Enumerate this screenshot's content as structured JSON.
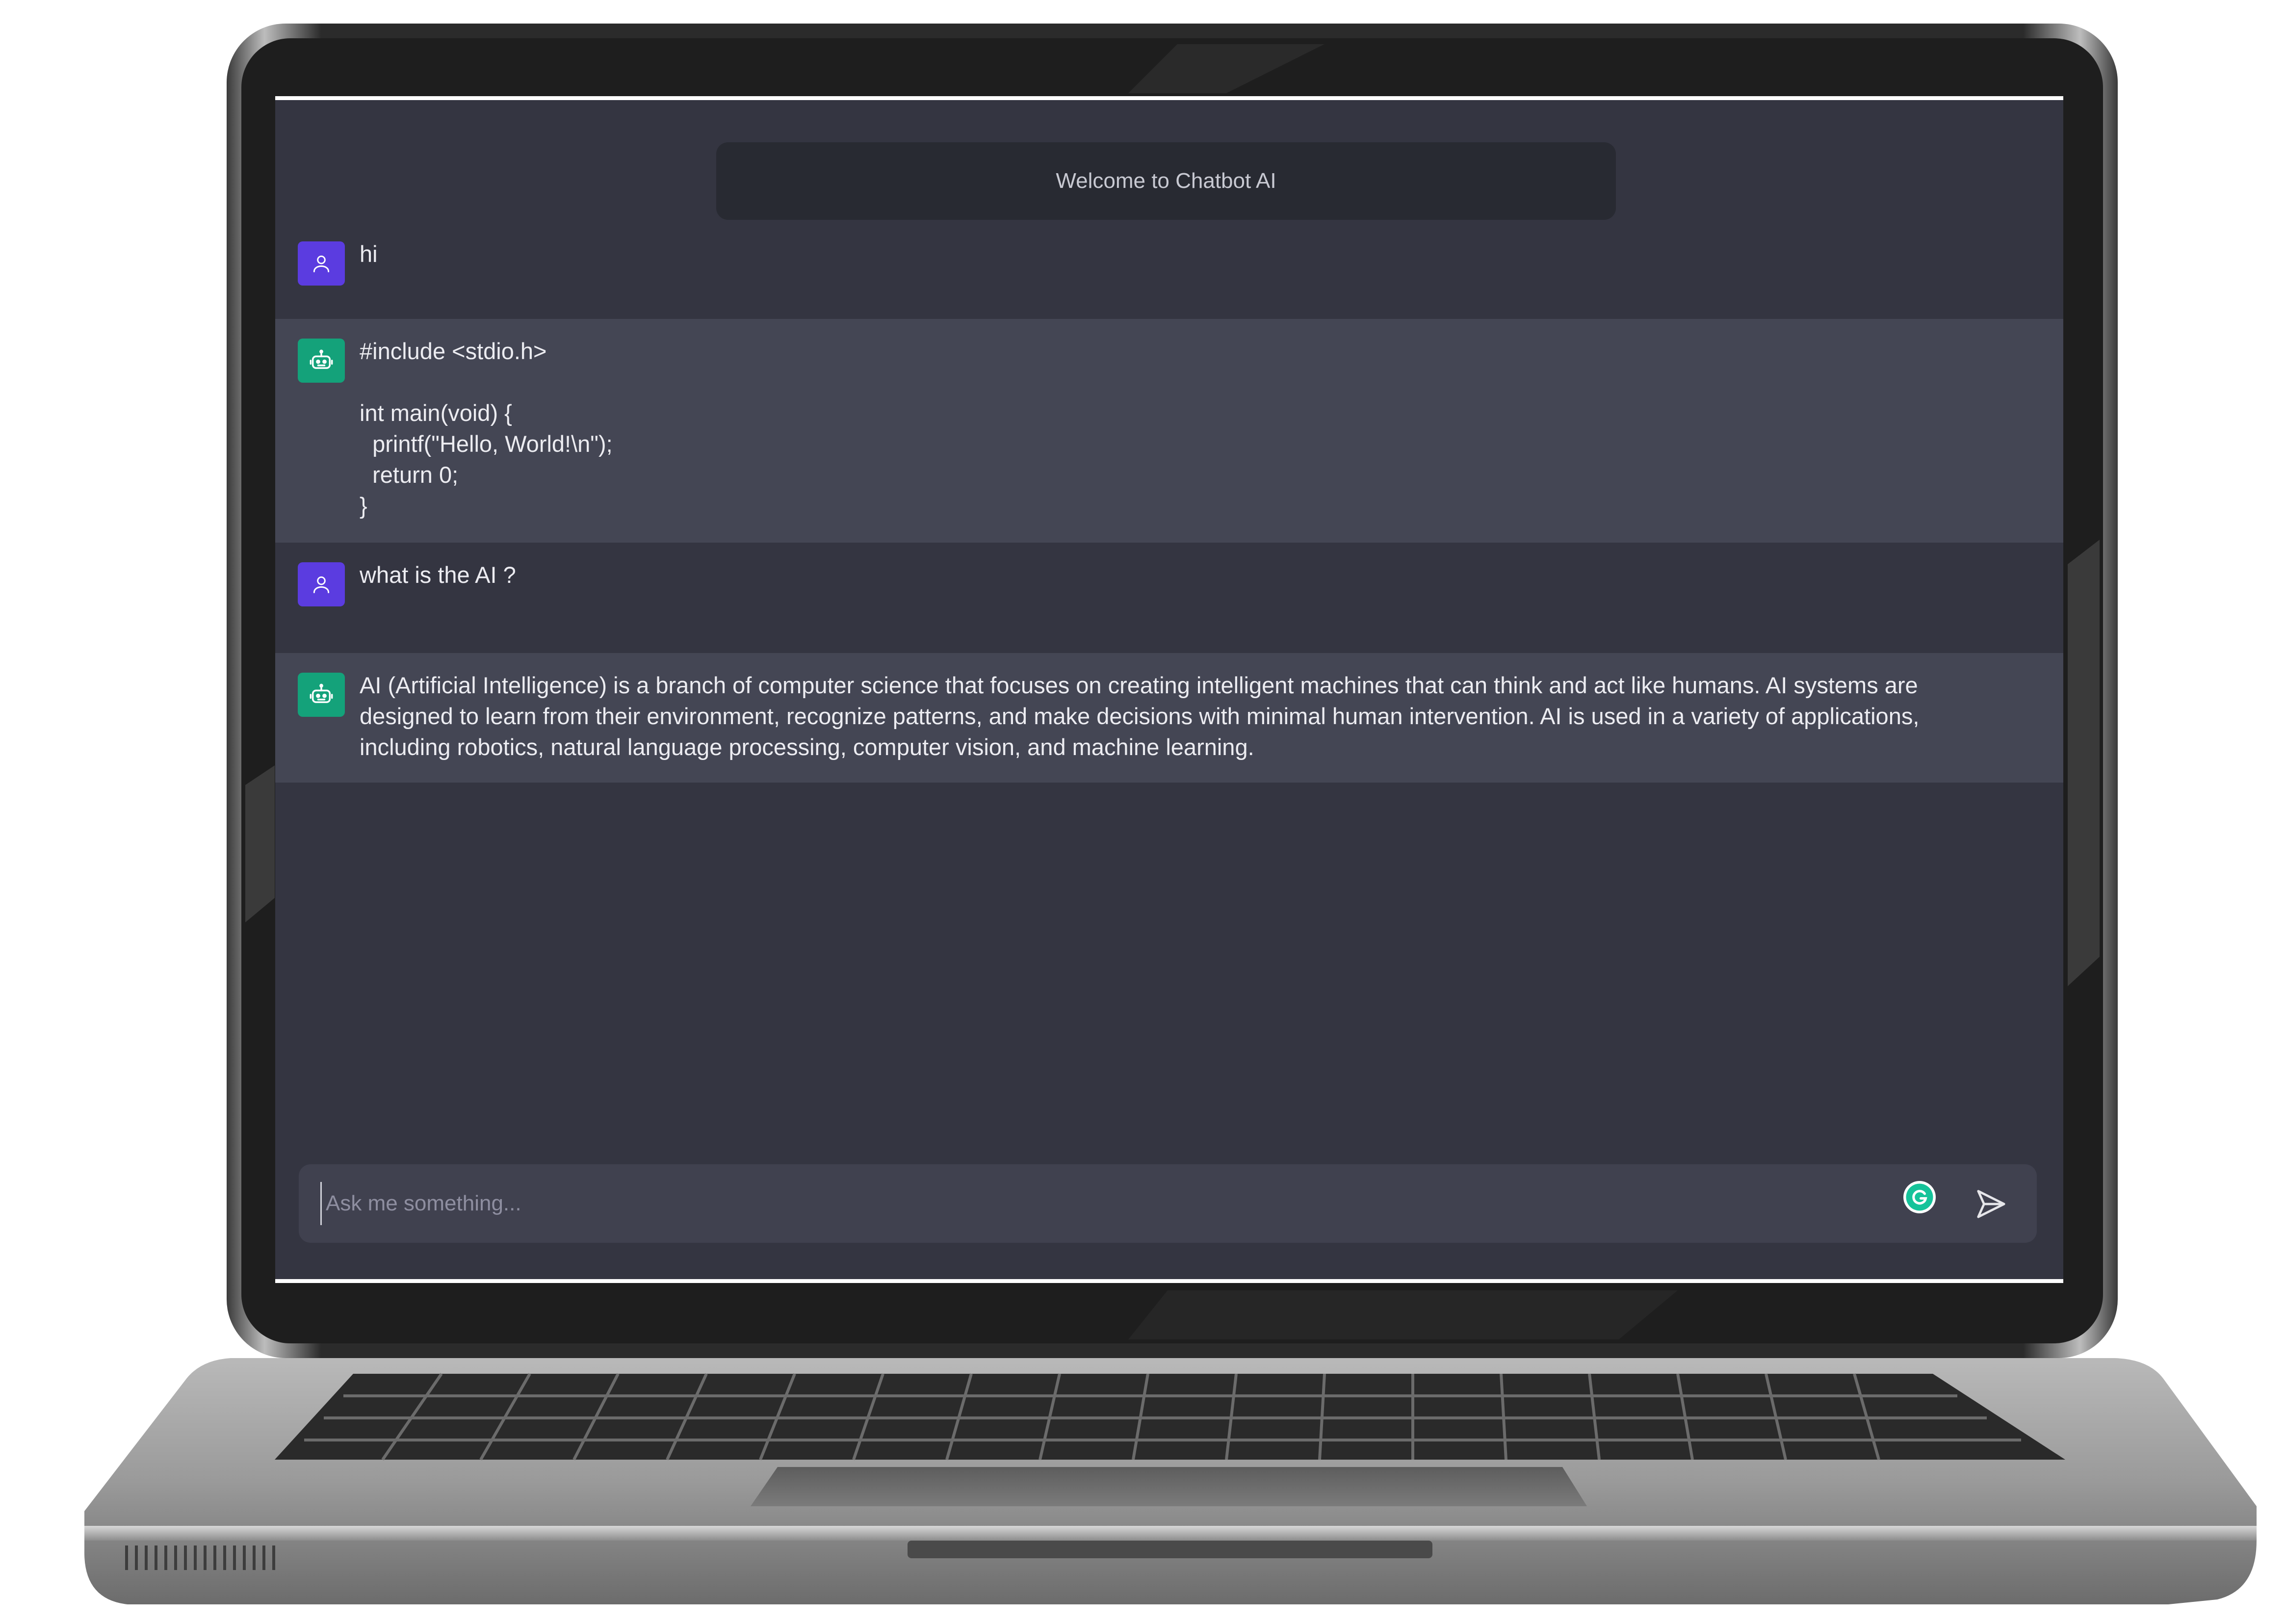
{
  "app": {
    "welcome_text": "Welcome to Chatbot AI"
  },
  "messages": [
    {
      "role": "user",
      "avatar_icon": "user-icon",
      "text": "hi"
    },
    {
      "role": "bot",
      "avatar_icon": "robot-icon",
      "text": "#include <stdio.h>\n\nint main(void) {\n  printf(\"Hello, World!\\n\");\n  return 0;\n}"
    },
    {
      "role": "user",
      "avatar_icon": "user-icon",
      "text": "what is the AI ?"
    },
    {
      "role": "bot",
      "avatar_icon": "robot-icon",
      "text": "AI (Artificial Intelligence) is a branch of computer science that focuses on creating intelligent machines that can think and act like humans. AI systems are designed to learn from their environment, recognize patterns, and make decisions with minimal human intervention. AI is used in a variety of applications, including robotics, natural language processing, computer vision, and machine learning."
    }
  ],
  "composer": {
    "placeholder": "Ask me something...",
    "value": "",
    "grammarly_icon": "grammarly-icon",
    "send_icon": "send-icon"
  },
  "colors": {
    "background": "#343541",
    "bot_message_bg": "#444654",
    "user_avatar": "#5b3ce0",
    "bot_avatar": "#14a27a",
    "input_bg": "#40414f",
    "welcome_bg": "#282a32"
  }
}
